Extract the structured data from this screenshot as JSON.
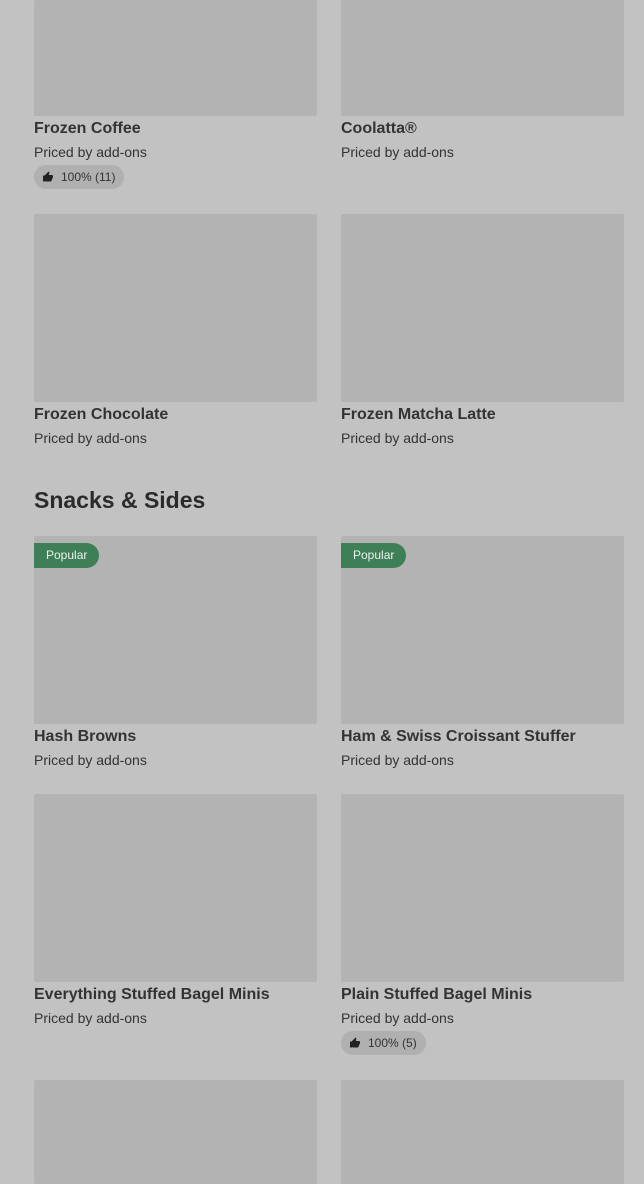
{
  "price_label": "Priced by add-ons",
  "section_title": "Snacks & Sides",
  "colors": {
    "background": "#c2c2c2",
    "placeholder": "#b3b3b3",
    "popular_badge": "#3f7f58"
  },
  "items": [
    {
      "name": "Frozen Coffee",
      "price": "Priced by add-ons",
      "rating": "100% (11)"
    },
    {
      "name": "Coolatta®",
      "price": "Priced by add-ons"
    },
    {
      "name": "Frozen Chocolate",
      "price": "Priced by add-ons"
    },
    {
      "name": "Frozen Matcha Latte",
      "price": "Priced by add-ons"
    },
    {
      "name": "Hash Browns",
      "price": "Priced by add-ons",
      "badge": "Popular"
    },
    {
      "name": "Ham & Swiss Croissant Stuffer",
      "price": "Priced by add-ons",
      "badge": "Popular"
    },
    {
      "name": "Everything Stuffed Bagel Minis",
      "price": "Priced by add-ons"
    },
    {
      "name": "Plain Stuffed Bagel Minis",
      "price": "Priced by add-ons",
      "rating": "100% (5)"
    }
  ],
  "icons": {
    "rating": "thumbs-up-icon"
  }
}
